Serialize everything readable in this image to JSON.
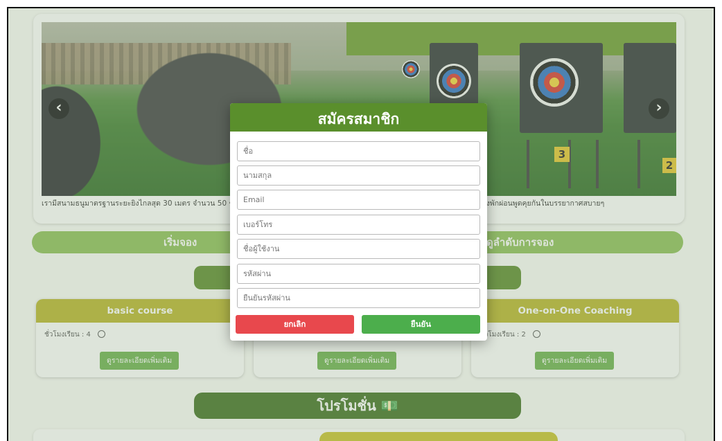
{
  "hero": {
    "caption": "เรามีสนามธนูมาตรฐานระยะยิงไกลสุด 30 เมตร จำนวน 50 ช่องยิง ให้ผู้มาเยี่ยมชมได้เพลิดเพลินหลังเลิกงาน พร้อมร้านกาแฟและเครื่องดื่ม ให้นั่งพักผ่อนพูดคุยกันในบรรยากาศสบายๆ",
    "prev_label": "‹",
    "next_label": "›",
    "number_3": "3",
    "number_2": "2"
  },
  "nav": {
    "start_label": "เริ่มจอง",
    "order_label": "ดูลำดับการจอง"
  },
  "courses": [
    {
      "title": "basic course",
      "hours": "ชั่วโมงเรียน : 4",
      "more_label": "ดูรายละเอียดเพิ่มเติม"
    },
    {
      "title": "",
      "hours": "",
      "more_label": "ดูรายละเอียดเพิ่มเติม"
    },
    {
      "title": "One-on-One Coaching",
      "hours": "ชั่วโมงเรียน : 2",
      "more_label": "ดูรายละเอียดเพิ่มเติม"
    }
  ],
  "promo": {
    "label": "โปรโมชั่น 💵"
  },
  "modal": {
    "title": "สมัครสมาชิก",
    "fields": {
      "first_name": "ชื่อ",
      "last_name": "นามสกุล",
      "email": "Email",
      "phone": "เบอร์โทร",
      "username": "ชื่อผู้ใช้งาน",
      "password": "รหัสผ่าน",
      "confirm_password": "ยืนยันรหัสผ่าน"
    },
    "cancel_label": "ยกเลิก",
    "confirm_label": "ยืนยัน"
  },
  "colors": {
    "header_green": "#5a8f2c",
    "pill_green": "#8dbf56",
    "course_head": "#b8b428",
    "cancel_red": "#e8484d",
    "confirm_green": "#4cae4c"
  }
}
